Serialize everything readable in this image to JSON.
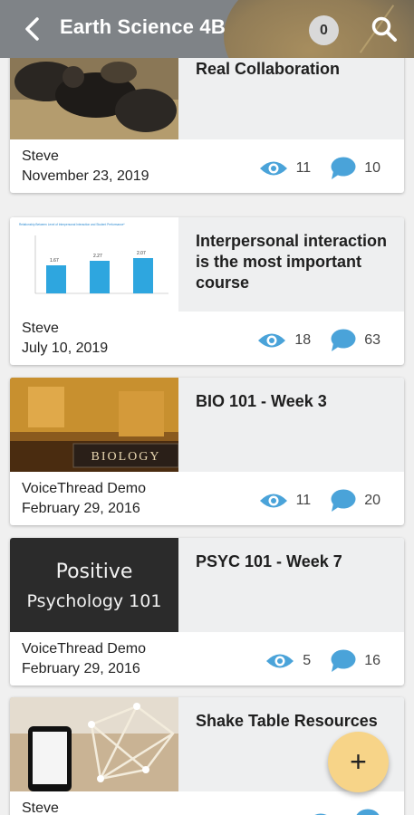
{
  "header": {
    "title": "Earth Science 4B",
    "notification_count": "0",
    "back_icon": "back-arrow-icon",
    "search_icon": "search-icon"
  },
  "colors": {
    "accent": "#4aa3d9",
    "fab": "#f7d488",
    "header": "#7f8387"
  },
  "cards": [
    {
      "title": "Real Collaboration",
      "author": "Steve",
      "date": "November 23, 2019",
      "views": "11",
      "comments": "10",
      "thumbnail": "gorillas-photo"
    },
    {
      "title": "Interpersonal interaction is the most important course",
      "author": "Steve",
      "date": "July 10, 2019",
      "views": "18",
      "comments": "63",
      "thumbnail": "bar-chart-slide",
      "thumb_text": {
        "heading": "Relationship Between Level of Interpersonal Interaction and Student Performance*",
        "values": [
          "1.67",
          "2.27",
          "2.07"
        ]
      }
    },
    {
      "title": "BIO 101 - Week 3",
      "author": "VoiceThread Demo",
      "date": "February 29, 2016",
      "views": "11",
      "comments": "20",
      "thumbnail": "biology-room-photo",
      "thumb_text": {
        "sign": "BIOLOGY"
      }
    },
    {
      "title": "PSYC 101 - Week 7",
      "author": "VoiceThread Demo",
      "date": "February 29, 2016",
      "views": "5",
      "comments": "16",
      "thumbnail": "chalkboard",
      "thumb_text": {
        "line1": "Positive",
        "line2": "Psychology 101"
      }
    },
    {
      "title": "Shake Table Resources",
      "author": "Steve",
      "date": "",
      "views": "",
      "comments": "",
      "thumbnail": "shake-table-photo"
    }
  ],
  "fab": {
    "label": "+"
  }
}
